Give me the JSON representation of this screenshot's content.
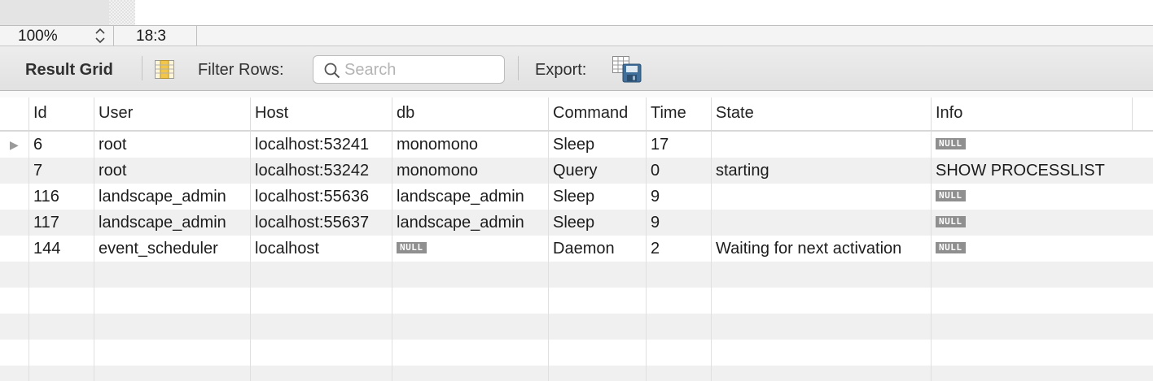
{
  "status_bar": {
    "zoom": "100%",
    "cursor": "18:3"
  },
  "toolbar": {
    "title": "Result Grid",
    "filter_label": "Filter Rows:",
    "search_placeholder": "Search",
    "export_label": "Export:"
  },
  "table": {
    "columns": [
      "Id",
      "User",
      "Host",
      "db",
      "Command",
      "Time",
      "State",
      "Info"
    ],
    "rows": [
      [
        "6",
        "root",
        "localhost:53241",
        "monomono",
        "Sleep",
        "17",
        "",
        "NULL"
      ],
      [
        "7",
        "root",
        "localhost:53242",
        "monomono",
        "Query",
        "0",
        "starting",
        "SHOW PROCESSLIST"
      ],
      [
        "116",
        "landscape_admin",
        "localhost:55636",
        "landscape_admin",
        "Sleep",
        "9",
        "",
        "NULL"
      ],
      [
        "117",
        "landscape_admin",
        "localhost:55637",
        "landscape_admin",
        "Sleep",
        "9",
        "",
        "NULL"
      ],
      [
        "144",
        "event_scheduler",
        "localhost",
        "NULL",
        "Daemon",
        "2",
        "Waiting for next activation",
        "NULL"
      ]
    ],
    "null_label": "NULL",
    "current_row_marker": "▶"
  },
  "icons": {
    "zoom_stepper": "chevron-up-down-icon",
    "grid_layout": "column-grid-icon",
    "search": "magnifier-icon",
    "export": "spreadsheet-save-icon"
  },
  "colors": {
    "null_badge": "#8f8f8f",
    "toolbar_bg": "#e6e6e6",
    "grid_stripe": "#f0f0f0"
  }
}
